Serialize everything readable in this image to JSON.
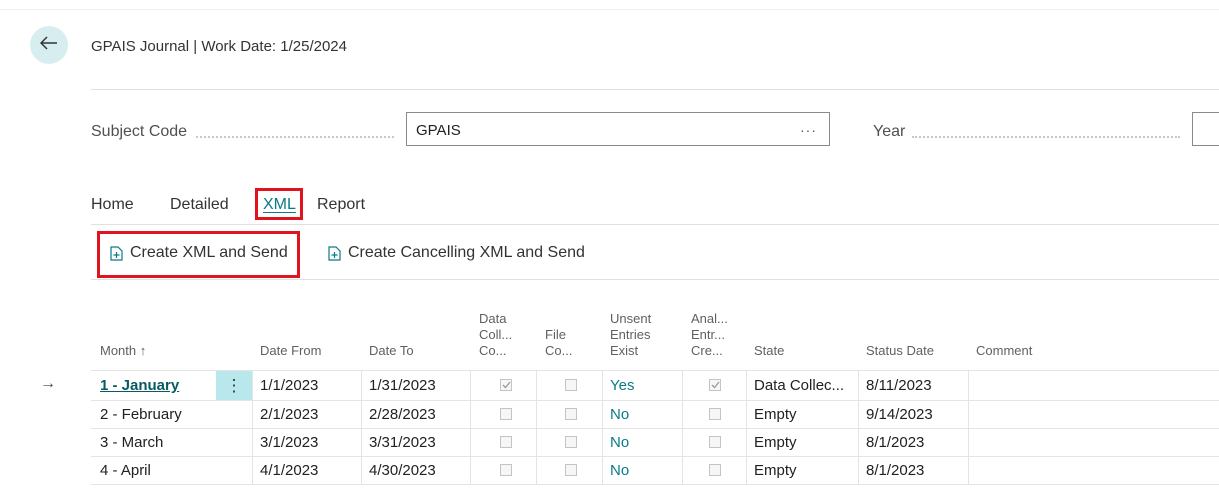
{
  "header": {
    "title": "GPAIS Journal | Work Date: 1/25/2024"
  },
  "fields": {
    "subject_code": {
      "label": "Subject Code",
      "value": "GPAIS",
      "lookup": "···"
    },
    "year": {
      "label": "Year",
      "value": ""
    }
  },
  "tabs": [
    {
      "label": "Home"
    },
    {
      "label": "Detailed"
    },
    {
      "label": "XML"
    },
    {
      "label": "Report"
    }
  ],
  "actions": [
    {
      "label": "Create XML and Send",
      "icon": "document-plus-icon"
    },
    {
      "label": "Create Cancelling XML and Send",
      "icon": "document-plus-icon"
    }
  ],
  "table": {
    "columns": {
      "month": "Month ↑",
      "date_from": "Date From",
      "date_to": "Date To",
      "data_coll": [
        "Data",
        "Coll...",
        "Co..."
      ],
      "file_co": [
        "File",
        "Co..."
      ],
      "unsent": [
        "Unsent",
        "Entries",
        "Exist"
      ],
      "anal": [
        "Anal...",
        "Entr...",
        "Cre..."
      ],
      "state": "State",
      "status_date": "Status Date",
      "comment": "Comment"
    },
    "rows": [
      {
        "month": "1 - January",
        "date_from": "1/1/2023",
        "date_to": "1/31/2023",
        "data_coll": true,
        "file_co": false,
        "unsent": "Yes",
        "anal": true,
        "state": "Data Collec...",
        "status_date": "8/11/2023",
        "comment": ""
      },
      {
        "month": "2 - February",
        "date_from": "2/1/2023",
        "date_to": "2/28/2023",
        "data_coll": false,
        "file_co": false,
        "unsent": "No",
        "anal": false,
        "state": "Empty",
        "status_date": "9/14/2023",
        "comment": ""
      },
      {
        "month": "3 - March",
        "date_from": "3/1/2023",
        "date_to": "3/31/2023",
        "data_coll": false,
        "file_co": false,
        "unsent": "No",
        "anal": false,
        "state": "Empty",
        "status_date": "8/1/2023",
        "comment": ""
      },
      {
        "month": "4 - April",
        "date_from": "4/1/2023",
        "date_to": "4/30/2023",
        "data_coll": false,
        "file_co": false,
        "unsent": "No",
        "anal": false,
        "state": "Empty",
        "status_date": "8/1/2023",
        "comment": ""
      }
    ],
    "row_menu": "⋮",
    "selected_row_marker": "→"
  },
  "colors": {
    "accent": "#0a7a85",
    "highlight": "#e0141e",
    "selected_cell": "#b8e7ec"
  }
}
